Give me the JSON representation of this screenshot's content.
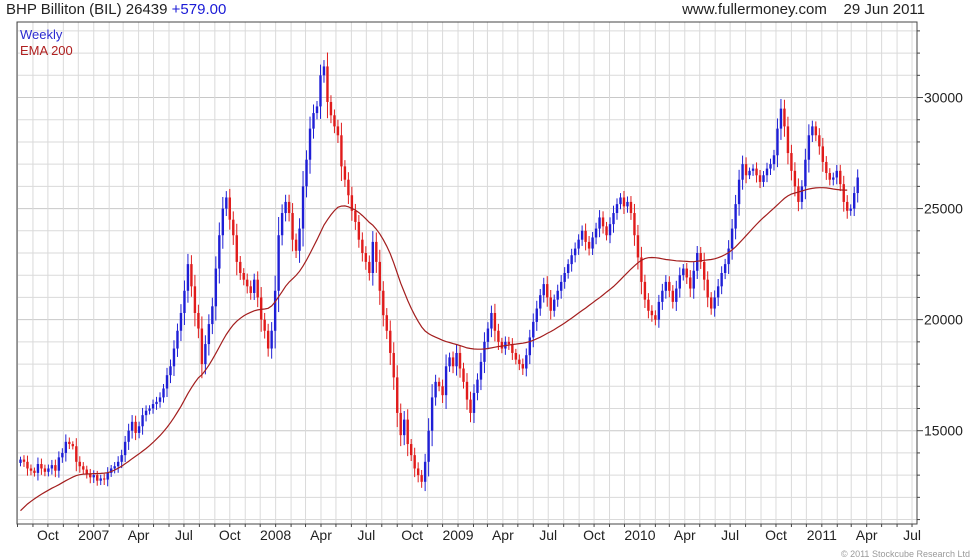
{
  "header": {
    "title": "BHP Billiton (BIL) 26439",
    "change": "+579.00",
    "site": "www.fullermoney.com",
    "date": "29 Jun 2011"
  },
  "legend": {
    "weekly": "Weekly",
    "ema": "EMA 200"
  },
  "footer": {
    "copyright": "© 2011 Stockcube Research Ltd"
  },
  "colors": {
    "up": "#1f1fd6",
    "down": "#e01b1b",
    "ema": "#a31e1e",
    "grid": "#dadada",
    "frame": "#444444"
  },
  "chart_data": {
    "type": "candlestick",
    "title": "BHP Billiton (BIL)",
    "xlabel": "",
    "ylabel": "",
    "ylim": [
      10800,
      33400
    ],
    "yticks": [
      15000,
      20000,
      25000,
      30000
    ],
    "grid": true,
    "legend_position": "top-left",
    "x_range": [
      "2006-07-31",
      "2011-07-11"
    ],
    "x_ticks": [
      {
        "label": "Oct",
        "date": "2006-10-01"
      },
      {
        "label": "2007",
        "date": "2007-01-01"
      },
      {
        "label": "Apr",
        "date": "2007-04-01"
      },
      {
        "label": "Jul",
        "date": "2007-07-01"
      },
      {
        "label": "Oct",
        "date": "2007-10-01"
      },
      {
        "label": "2008",
        "date": "2008-01-01"
      },
      {
        "label": "Apr",
        "date": "2008-04-01"
      },
      {
        "label": "Jul",
        "date": "2008-07-01"
      },
      {
        "label": "Oct",
        "date": "2008-10-01"
      },
      {
        "label": "2009",
        "date": "2009-01-01"
      },
      {
        "label": "Apr",
        "date": "2009-04-01"
      },
      {
        "label": "Jul",
        "date": "2009-07-01"
      },
      {
        "label": "Oct",
        "date": "2009-10-01"
      },
      {
        "label": "2010",
        "date": "2010-01-01"
      },
      {
        "label": "Apr",
        "date": "2010-04-01"
      },
      {
        "label": "Jul",
        "date": "2010-07-01"
      },
      {
        "label": "Oct",
        "date": "2010-10-01"
      },
      {
        "label": "2011",
        "date": "2011-01-01"
      },
      {
        "label": "Apr",
        "date": "2011-04-01"
      },
      {
        "label": "Jul",
        "date": "2011-07-01"
      }
    ],
    "series": [
      {
        "name": "Weekly",
        "kind": "weekly closing prices (approx.)",
        "start_date": "2006-08-07",
        "interval_days": 7,
        "values": [
          13700,
          13600,
          13300,
          13200,
          13100,
          13500,
          13300,
          13150,
          13300,
          13450,
          13200,
          13800,
          14000,
          14500,
          14400,
          14300,
          13600,
          13400,
          13250,
          13050,
          12900,
          13000,
          12750,
          12850,
          12800,
          13100,
          13300,
          13400,
          13600,
          13900,
          14500,
          15000,
          15400,
          14900,
          15200,
          15700,
          15900,
          16000,
          16200,
          16300,
          16500,
          16900,
          17500,
          17900,
          18700,
          19500,
          20300,
          21300,
          22500,
          21500,
          20300,
          19600,
          18000,
          18900,
          19800,
          20600,
          22300,
          23800,
          25000,
          25500,
          24500,
          23800,
          22600,
          22100,
          21800,
          21500,
          21200,
          21800,
          21000,
          20000,
          19500,
          18700,
          19500,
          21300,
          23800,
          24800,
          25300,
          24800,
          23600,
          23100,
          24100,
          26000,
          27200,
          28600,
          29300,
          29600,
          31000,
          31400,
          29800,
          29200,
          28700,
          28300,
          26900,
          26300,
          25600,
          24900,
          24400,
          23600,
          23000,
          22600,
          22100,
          23500,
          22600,
          21300,
          20200,
          19500,
          18500,
          17400,
          15800,
          14800,
          15500,
          14400,
          13900,
          13300,
          13000,
          12700,
          13600,
          15000,
          16500,
          17200,
          17000,
          16600,
          17900,
          18300,
          17900,
          18500,
          17800,
          17200,
          16400,
          15800,
          16700,
          17300,
          18100,
          19000,
          19600,
          20300,
          19500,
          19000,
          18700,
          19000,
          18900,
          18500,
          18200,
          18000,
          17800,
          18400,
          19200,
          19900,
          20500,
          21100,
          21600,
          21000,
          20400,
          20900,
          21300,
          21700,
          22100,
          22500,
          22900,
          23200,
          23600,
          24000,
          23500,
          23200,
          23700,
          24100,
          24600,
          24200,
          23800,
          24300,
          24800,
          25200,
          25500,
          25100,
          25300,
          24800,
          23800,
          22800,
          21700,
          20900,
          20400,
          20200,
          20000,
          20800,
          21300,
          21700,
          21300,
          20800,
          21400,
          22000,
          22300,
          21900,
          21400,
          22200,
          23000,
          22600,
          21800,
          21000,
          20500,
          21000,
          21500,
          22100,
          22500,
          23200,
          24100,
          25200,
          26300,
          27000,
          26500,
          26700,
          26800,
          26500,
          26200,
          26500,
          26800,
          27000,
          27400,
          28600,
          29500,
          28700,
          27500,
          26700,
          26000,
          25300,
          26000,
          27200,
          28300,
          28700,
          28300,
          27800,
          27100,
          26600,
          26300,
          26400,
          26700,
          26100,
          25300,
          24900,
          25000,
          25700,
          26400
        ]
      },
      {
        "name": "EMA 200",
        "kind": "200-day exponential moving average (weekly samples, approx.)",
        "values": [
          11400,
          11550,
          11700,
          11820,
          11930,
          12040,
          12140,
          12230,
          12320,
          12410,
          12490,
          12570,
          12660,
          12750,
          12830,
          12910,
          12980,
          13020,
          13040,
          13050,
          13060,
          13070,
          13070,
          13080,
          13090,
          13110,
          13160,
          13230,
          13310,
          13400,
          13510,
          13620,
          13740,
          13850,
          13960,
          14080,
          14200,
          14330,
          14470,
          14620,
          14780,
          14960,
          15150,
          15360,
          15590,
          15840,
          16100,
          16380,
          16670,
          16930,
          17170,
          17380,
          17520,
          17720,
          17950,
          18200,
          18480,
          18770,
          19060,
          19330,
          19560,
          19770,
          19930,
          20060,
          20170,
          20260,
          20330,
          20400,
          20440,
          20460,
          20480,
          20510,
          20620,
          20800,
          21030,
          21260,
          21500,
          21690,
          21840,
          21990,
          22180,
          22410,
          22680,
          22980,
          23290,
          23600,
          23930,
          24260,
          24500,
          24720,
          24910,
          25060,
          25110,
          25120,
          25080,
          25010,
          24930,
          24820,
          24690,
          24540,
          24380,
          24250,
          24070,
          23860,
          23600,
          23300,
          22960,
          22560,
          22100,
          21640,
          21250,
          20860,
          20510,
          20200,
          19920,
          19670,
          19490,
          19370,
          19280,
          19210,
          19140,
          19070,
          19010,
          18970,
          18920,
          18880,
          18830,
          18780,
          18730,
          18700,
          18680,
          18670,
          18670,
          18680,
          18700,
          18730,
          18760,
          18790,
          18810,
          18830,
          18860,
          18880,
          18900,
          18920,
          18940,
          18970,
          19010,
          19070,
          19140,
          19210,
          19290,
          19380,
          19460,
          19550,
          19650,
          19750,
          19850,
          19960,
          20070,
          20180,
          20300,
          20410,
          20520,
          20640,
          20760,
          20880,
          20990,
          21110,
          21240,
          21360,
          21490,
          21640,
          21800,
          21960,
          22120,
          22280,
          22420,
          22560,
          22670,
          22750,
          22790,
          22800,
          22790,
          22770,
          22740,
          22710,
          22690,
          22670,
          22650,
          22640,
          22630,
          22620,
          22610,
          22610,
          22630,
          22650,
          22670,
          22690,
          22710,
          22740,
          22790,
          22850,
          22930,
          23020,
          23140,
          23280,
          23440,
          23610,
          23780,
          23950,
          24120,
          24290,
          24450,
          24600,
          24740,
          24880,
          25020,
          25170,
          25320,
          25460,
          25570,
          25650,
          25700,
          25740,
          25790,
          25840,
          25880,
          25910,
          25930,
          25940,
          25940,
          25930,
          25910,
          25880,
          25860,
          25840,
          25830,
          25830
        ]
      }
    ]
  }
}
